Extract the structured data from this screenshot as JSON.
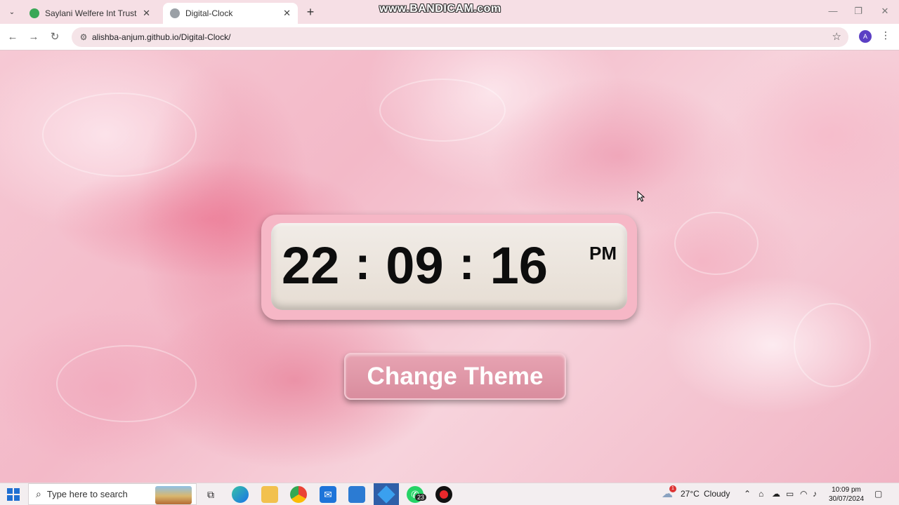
{
  "browser": {
    "tabs": [
      {
        "title": "Saylani Welfere Int Trust",
        "active": false
      },
      {
        "title": "Digital-Clock",
        "active": true
      }
    ],
    "url": "alishba-anjum.github.io/Digital-Clock/",
    "profile_initial": "A",
    "watermark": "www.BANDICAM.com"
  },
  "page": {
    "clock": {
      "hours": "22",
      "minutes": "09",
      "seconds": "16",
      "separator": ":",
      "period": "PM"
    },
    "theme_button_label": "Change Theme"
  },
  "taskbar": {
    "search_placeholder": "Type here to search",
    "weather_temp": "27°C",
    "weather_condition": "Cloudy",
    "weather_alert_count": "1",
    "whatsapp_badge": "23",
    "time": "10:09 pm",
    "date": "30/07/2024"
  },
  "colors": {
    "clock_frame": "#f6b7c6",
    "clock_face": "#ebe4dc",
    "button": "#df98a8",
    "digit": "#0d0d0d"
  }
}
